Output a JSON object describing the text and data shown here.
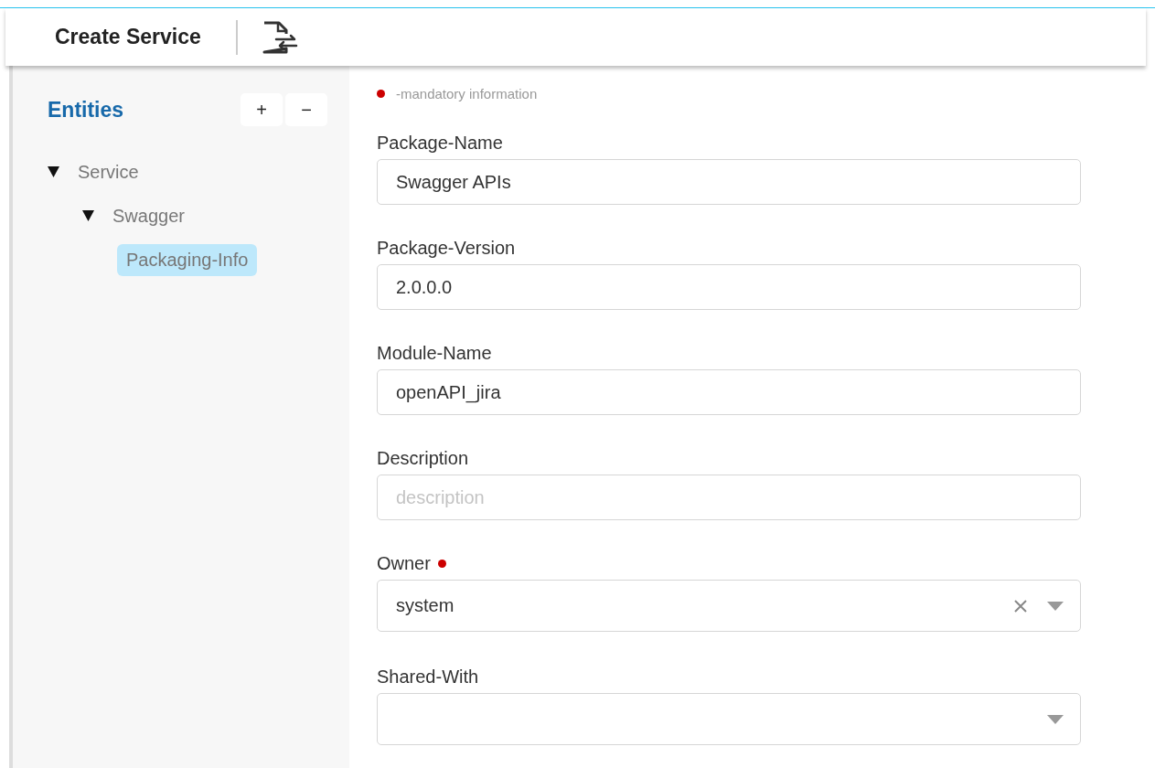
{
  "header": {
    "title": "Create Service"
  },
  "sidebar": {
    "title": "Entities",
    "buttons": [
      "+",
      "−"
    ],
    "tree": [
      {
        "label": "Service",
        "expanded": true,
        "selected": false,
        "children": [
          {
            "label": "Swagger",
            "expanded": true,
            "selected": false,
            "children": [
              {
                "label": "Packaging-Info",
                "selected": true
              }
            ]
          }
        ]
      }
    ]
  },
  "legend": {
    "text": "-mandatory information"
  },
  "fields": [
    {
      "label": "Package-Name",
      "kind": "text",
      "value": "Swagger APIs",
      "required": false
    },
    {
      "label": "Package-Version",
      "kind": "text",
      "value": "2.0.0.0",
      "required": false
    },
    {
      "label": "Module-Name",
      "kind": "text",
      "value": "openAPI_jira",
      "required": false
    },
    {
      "label": "Description",
      "kind": "text",
      "placeholder": "description",
      "required": false
    },
    {
      "label": "Owner",
      "kind": "select",
      "value": "system",
      "required": true,
      "clearable": true
    },
    {
      "label": "Shared-With",
      "kind": "select",
      "required": false,
      "clearable": false
    }
  ]
}
